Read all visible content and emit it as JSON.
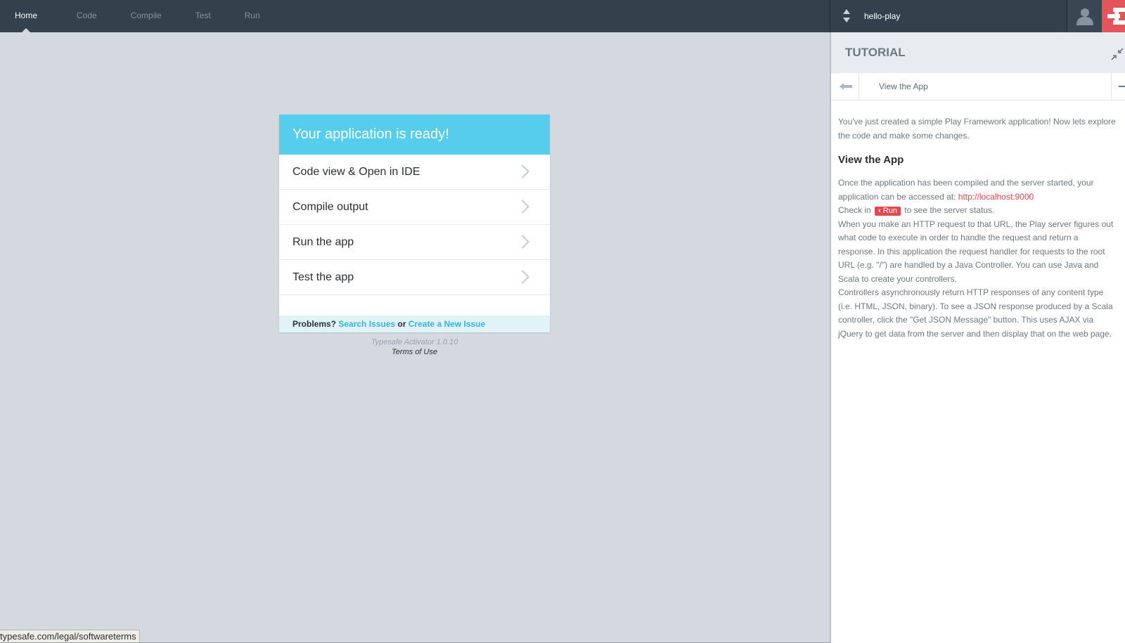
{
  "nav": {
    "items": [
      {
        "label": "Home"
      },
      {
        "label": "Code"
      },
      {
        "label": "Compile"
      },
      {
        "label": "Test"
      },
      {
        "label": "Run"
      }
    ]
  },
  "project": {
    "name": "hello-play"
  },
  "card": {
    "title": "Your application is ready!",
    "items": [
      {
        "label": "Code view & Open in IDE"
      },
      {
        "label": "Compile output"
      },
      {
        "label": "Run the app"
      },
      {
        "label": "Test the app"
      }
    ],
    "footer": {
      "problems": "Problems?",
      "search_issues": "Search Issues",
      "or": "or",
      "create_issue": "Create a New Issue"
    },
    "version": "Typesafe Activator 1.0.10",
    "terms": "Terms of Use"
  },
  "tutorial": {
    "title": "TUTORIAL",
    "page_title": "View the App",
    "intro_line1": "You've just created a simple Play Framework application! Now lets explore",
    "intro_line2": "the code and make some changes.",
    "heading": "View the App",
    "lines": {
      "l1": "Once the application has been compiled and the server started, your",
      "l2": "application can be accessed at:",
      "url": "http://localhost:9000",
      "check_pre": "Check in",
      "run_badge": "Run",
      "check_post": "to see the server status.",
      "l4": "When you make an HTTP request to that URL, the Play server figures out",
      "l5": "what code to execute in order to handle the request and return a",
      "l6": "response. In this application the request handler for requests to the root",
      "l7": "URL (e.g. \"/\") are handled by a Java Controller. You can use Java and",
      "l8": "Scala to create your controllers.",
      "l9": "Controllers asynchronously return HTTP responses of any content type",
      "l10": "(i.e. HTML, JSON, binary). To see a JSON response produced by a Scala",
      "l11": "controller, click the \"Get JSON Message\" button. This uses AJAX via",
      "l12": "jQuery to get data from the server and then display that on the web page."
    }
  },
  "statusbar": {
    "text": "typesafe.com/legal/softwareterms"
  },
  "colors": {
    "topbar": "#34404c",
    "accent_blue": "#56cdec",
    "accent_red": "#e2474d",
    "background": "#d4d9e0"
  },
  "icons": {
    "user": "user-icon",
    "logo": "typesafe-logo-icon",
    "collapse": "collapse-icon",
    "prev": "arrow-left-icon",
    "chevron": "chevron-right-icon"
  }
}
